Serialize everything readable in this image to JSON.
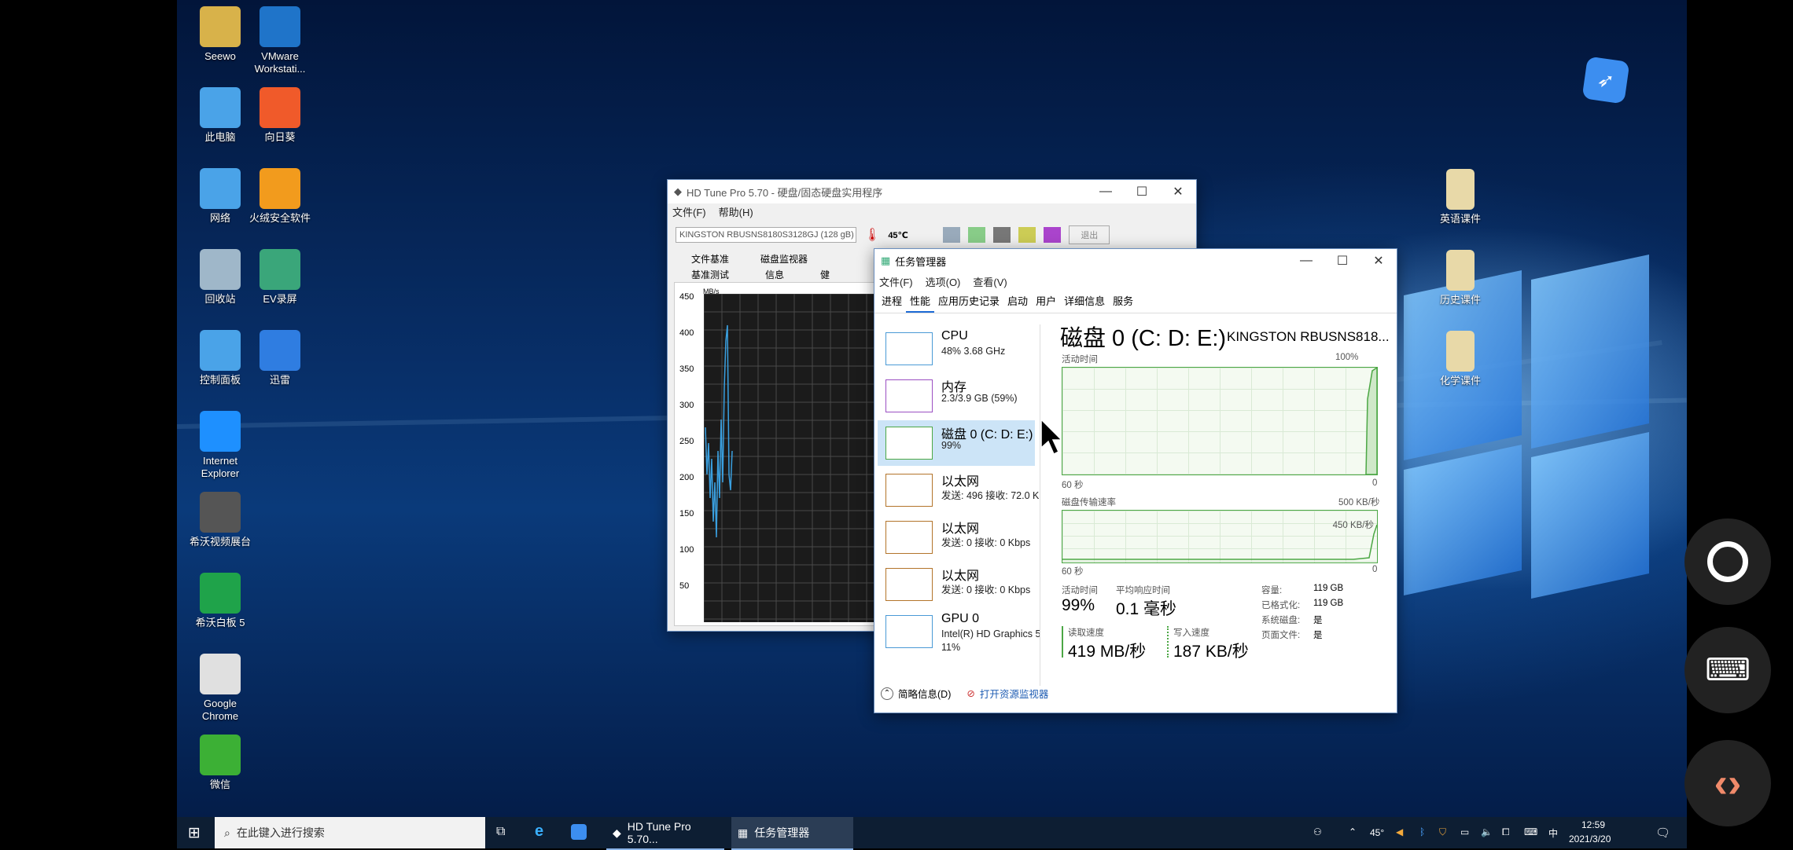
{
  "desktop_icons_left": [
    {
      "label": "Seewo",
      "icon": "folder-user-icon",
      "color": "#d8b24a"
    },
    {
      "label": "VMware Workstati...",
      "icon": "vmware-icon",
      "color": "#1f74c9"
    },
    {
      "label": "此电脑",
      "icon": "computer-icon",
      "color": "#4aa3e8"
    },
    {
      "label": "向日葵",
      "icon": "sunflower-icon",
      "color": "#f05a2a"
    },
    {
      "label": "网络",
      "icon": "network-icon",
      "color": "#4aa3e8"
    },
    {
      "label": "火绒安全软件",
      "icon": "huorong-icon",
      "color": "#f29b1d"
    },
    {
      "label": "回收站",
      "icon": "recycle-bin-icon",
      "color": "#9fb7c9"
    },
    {
      "label": "EV录屏",
      "icon": "ev-recorder-icon",
      "color": "#3aa67a"
    },
    {
      "label": "控制面板",
      "icon": "control-panel-icon",
      "color": "#4aa3e8"
    },
    {
      "label": "迅雷",
      "icon": "xunlei-icon",
      "color": "#2f7de1"
    },
    {
      "label": "Internet Explorer",
      "icon": "ie-icon",
      "color": "#1e90ff"
    },
    {
      "label": "希沃视频展台",
      "icon": "camera-icon",
      "color": "#555555"
    },
    {
      "label": "希沃白板 5",
      "icon": "en-board-icon",
      "color": "#1fa34a"
    },
    {
      "label": "Google Chrome",
      "icon": "chrome-icon",
      "color": "#e0e0e0"
    },
    {
      "label": "微信",
      "icon": "wechat-icon",
      "color": "#3cb035"
    }
  ],
  "desktop_icons_right": [
    {
      "label": "英语课件",
      "icon": "folder-icon"
    },
    {
      "label": "历史课件",
      "icon": "folder-icon"
    },
    {
      "label": "化学课件",
      "icon": "folder-icon"
    }
  ],
  "hdtune": {
    "title": "HD Tune Pro 5.70 - 硬盘/固态硬盘实用程序",
    "menu": [
      "文件(F)",
      "帮助(H)"
    ],
    "drive": "KINGSTON RBUSNS8180S3128GJ (128 gB)",
    "temp": "45℃",
    "exit": "退出",
    "tabs_row1": [
      "文件基准",
      "磁盘监视器"
    ],
    "tabs_row2": [
      "基准测试",
      "信息",
      "健"
    ],
    "unit": "MB/s",
    "y_ticks": [
      "450",
      "400",
      "350",
      "300",
      "250",
      "200",
      "150",
      "100",
      "50"
    ]
  },
  "taskmgr": {
    "title": "任务管理器",
    "menu": [
      "文件(F)",
      "选项(O)",
      "查看(V)"
    ],
    "tabs": [
      "进程",
      "性能",
      "应用历史记录",
      "启动",
      "用户",
      "详细信息",
      "服务"
    ],
    "active_tab": "性能",
    "side": [
      {
        "name": "CPU",
        "sub": "48%  3.68 GHz",
        "color": "#4a9ad6"
      },
      {
        "name": "内存",
        "sub": "2.3/3.9 GB (59%)",
        "color": "#9b4fc2"
      },
      {
        "name": "磁盘 0 (C: D: E:)",
        "sub": "99%",
        "color": "#4ca745"
      },
      {
        "name": "以太网",
        "sub": "发送: 496  接收: 72.0 K",
        "color": "#b3742a"
      },
      {
        "name": "以太网",
        "sub": "发送: 0  接收: 0 Kbps",
        "color": "#b3742a"
      },
      {
        "name": "以太网",
        "sub": "发送: 0  接收: 0 Kbps",
        "color": "#b3742a"
      },
      {
        "name": "GPU 0",
        "sub": "Intel(R) HD Graphics 5",
        "sub2": "11%",
        "color": "#4a9ad6"
      }
    ],
    "heading": "磁盘 0 (C: D: E:)",
    "model": "KINGSTON RBUSNS818...",
    "graph1_label": "活动时间",
    "graph1_max": "100%",
    "graph1_left": "60 秒",
    "graph1_right": "0",
    "graph2_label": "磁盘传输速率",
    "graph2_max": "500 KB/秒",
    "graph2_inner": "450 KB/秒",
    "graph2_left": "60 秒",
    "graph2_right": "0",
    "stats": {
      "active_label": "活动时间",
      "active_val": "99%",
      "resp_label": "平均响应时间",
      "resp_val": "0.1 毫秒",
      "read_label": "读取速度",
      "read_val": "419 MB/秒",
      "write_label": "写入速度",
      "write_val": "187 KB/秒",
      "cap_label": "容量:",
      "cap_val": "119 GB",
      "fmt_label": "已格式化:",
      "fmt_val": "119 GB",
      "sys_label": "系统磁盘:",
      "sys_val": "是",
      "page_label": "页面文件:",
      "page_val": "是"
    },
    "footer_less": "简略信息(D)",
    "footer_monitor": "打开资源监视器"
  },
  "taskbar": {
    "search_placeholder": "在此键入进行搜索",
    "app1": "HD Tune Pro 5.70...",
    "app2": "任务管理器",
    "temp": "45°",
    "ime": "中",
    "time": "12:59",
    "date": "2021/3/20"
  }
}
